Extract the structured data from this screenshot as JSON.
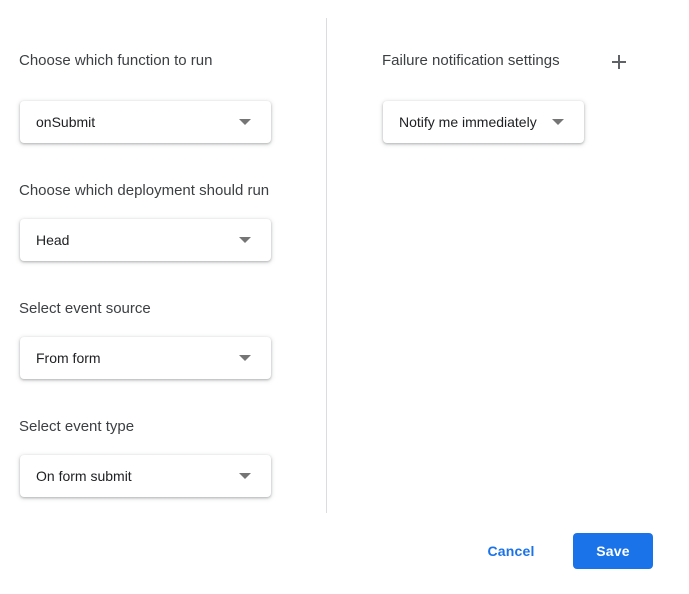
{
  "left": {
    "function": {
      "label": "Choose which function to run",
      "value": "onSubmit"
    },
    "deployment": {
      "label": "Choose which deployment should run",
      "value": "Head"
    },
    "event_source": {
      "label": "Select event source",
      "value": "From form"
    },
    "event_type": {
      "label": "Select event type",
      "value": "On form submit"
    }
  },
  "right": {
    "failure": {
      "label": "Failure notification settings",
      "value": "Notify me immediately",
      "add_icon": "plus-icon"
    }
  },
  "footer": {
    "cancel_label": "Cancel",
    "save_label": "Save"
  },
  "colors": {
    "accent": "#1a73e8",
    "divider": "#dadce0",
    "text": "#3c4043"
  }
}
